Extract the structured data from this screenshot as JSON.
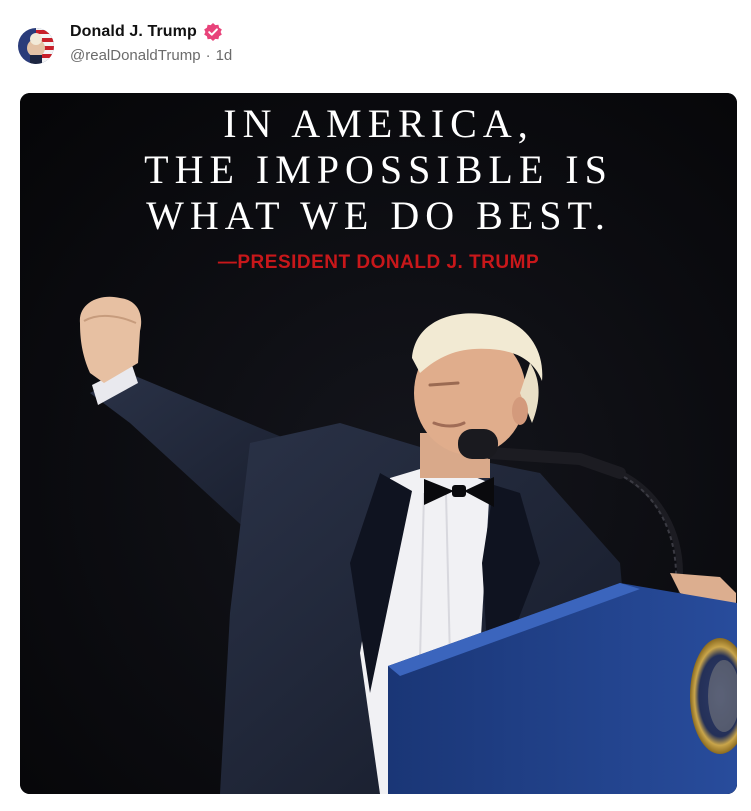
{
  "post": {
    "author": {
      "display_name": "Donald J. Trump",
      "handle": "@realDonaldTrump",
      "separator": "·",
      "time_ago": "1d",
      "verified": true,
      "verified_badge_color": "#e8437a"
    },
    "image": {
      "quote_lines": [
        "IN AMERICA,",
        "THE IMPOSSIBLE IS",
        "WHAT WE DO BEST."
      ],
      "attribution": "—PRESIDENT DONALD J. TRUMP",
      "colors": {
        "background": "#07070a",
        "quote_text": "#ffffff",
        "attribution_text": "#c8171a",
        "podium": "#1f3f86"
      }
    }
  }
}
